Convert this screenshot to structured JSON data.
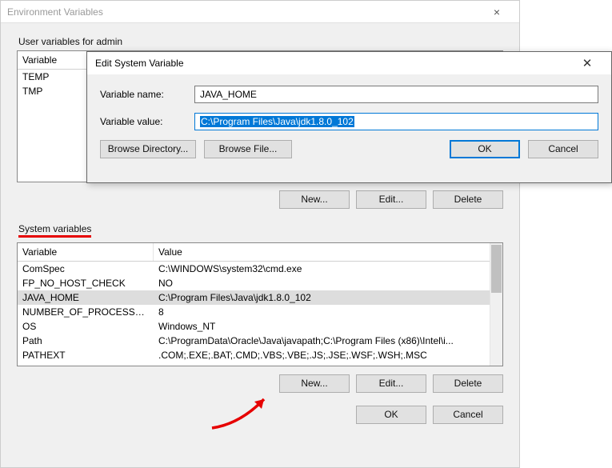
{
  "parent": {
    "title": "Environment Variables",
    "user_section_label": "User variables for admin",
    "system_section_label": "System variables",
    "columns": {
      "variable": "Variable",
      "value": "Value"
    },
    "user_vars": [
      {
        "name": "TEMP",
        "value": ""
      },
      {
        "name": "TMP",
        "value": ""
      }
    ],
    "system_vars": [
      {
        "name": "ComSpec",
        "value": "C:\\WINDOWS\\system32\\cmd.exe"
      },
      {
        "name": "FP_NO_HOST_CHECK",
        "value": "NO"
      },
      {
        "name": "JAVA_HOME",
        "value": "C:\\Program Files\\Java\\jdk1.8.0_102"
      },
      {
        "name": "NUMBER_OF_PROCESSORS",
        "value": "8"
      },
      {
        "name": "OS",
        "value": "Windows_NT"
      },
      {
        "name": "Path",
        "value": "C:\\ProgramData\\Oracle\\Java\\javapath;C:\\Program Files (x86)\\Intel\\i..."
      },
      {
        "name": "PATHEXT",
        "value": ".COM;.EXE;.BAT;.CMD;.VBS;.VBE;.JS;.JSE;.WSF;.WSH;.MSC"
      }
    ],
    "buttons": {
      "new": "New...",
      "edit": "Edit...",
      "delete": "Delete",
      "ok": "OK",
      "cancel": "Cancel"
    }
  },
  "modal": {
    "title": "Edit System Variable",
    "name_label": "Variable name:",
    "value_label": "Variable value:",
    "name_value": "JAVA_HOME",
    "value_value": "C:\\Program Files\\Java\\jdk1.8.0_102",
    "buttons": {
      "browse_dir": "Browse Directory...",
      "browse_file": "Browse File...",
      "ok": "OK",
      "cancel": "Cancel"
    }
  }
}
